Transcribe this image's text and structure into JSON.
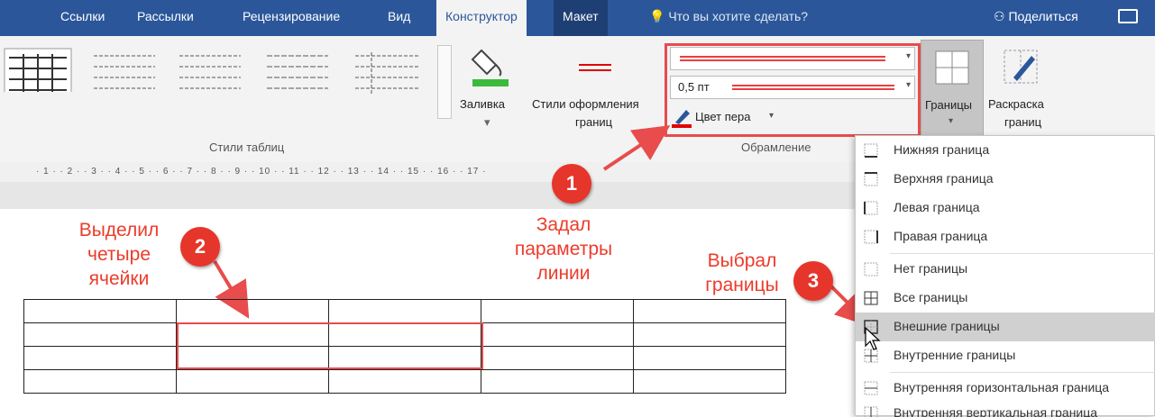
{
  "tabs": [
    "Ссылки",
    "Рассылки",
    "Рецензирование",
    "Вид",
    "Конструктор",
    "Макет"
  ],
  "tell_me": "Что вы хотите сделать?",
  "share": "Поделиться",
  "ribbon": {
    "fill_label": "Заливка",
    "border_styles_line1": "Стили оформления",
    "border_styles_line2": "границ",
    "line_weight": "0,5 пт",
    "pen_color": "Цвет пера",
    "borders_label": "Границы",
    "border_painter_line1": "Раскраска",
    "border_painter_line2": "границ",
    "group_table_styles": "Стили таблиц",
    "group_borders": "Обрамление"
  },
  "ruler_text": "· 1 · · 2 · · 3 · · 4 · · 5 · · 6 · · 7 · · 8 · · 9 · · 10 · · 11 · · 12 · · 13 · · 14 · · 15 · · 16 · · 17 ·",
  "annotations": {
    "a1": "Выделил четыре ячейки",
    "a2": "Задал параметры линии",
    "a3": "Выбрал границы"
  },
  "badges": [
    "1",
    "2",
    "3"
  ],
  "menu": {
    "items": [
      "Нижняя граница",
      "Верхняя граница",
      "Левая граница",
      "Правая граница",
      "Нет границы",
      "Все границы",
      "Внешние границы",
      "Внутренние границы",
      "Внутренняя горизонтальная граница",
      "Внутренняя вертикальная граница"
    ]
  },
  "colors": {
    "accent": "#2b579a",
    "annotation": "#e84c4c",
    "pen": "#e00000"
  }
}
